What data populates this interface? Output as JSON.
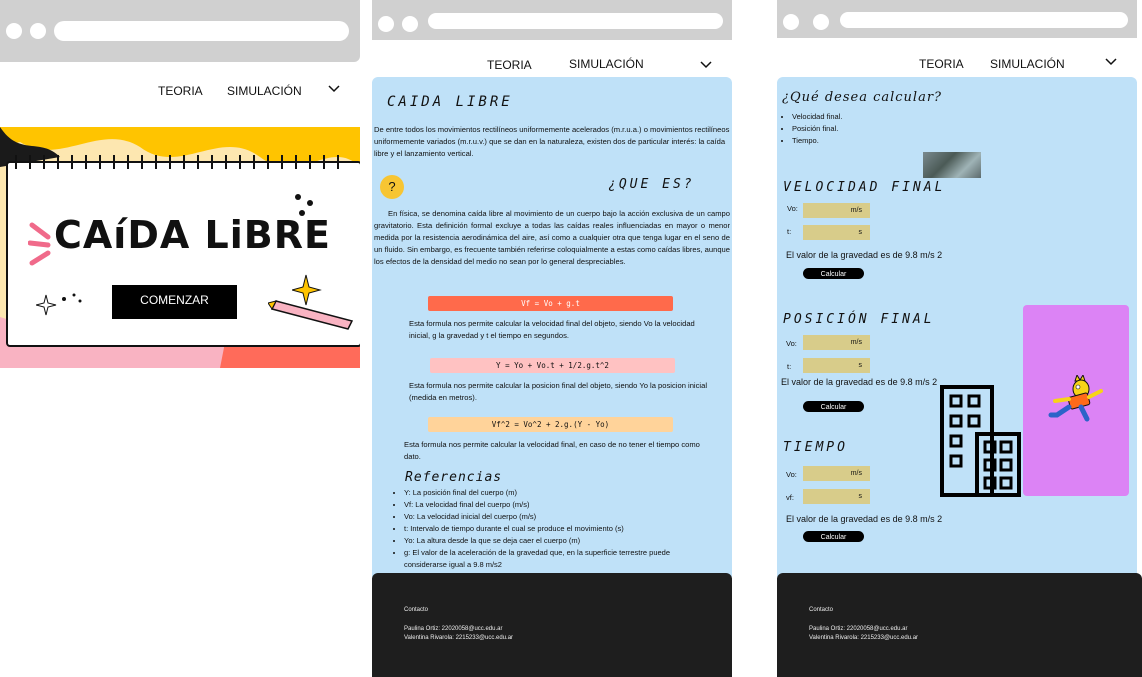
{
  "nav": {
    "teoria": "TEORIA",
    "simulacion": "SIMULACIÓN"
  },
  "home": {
    "title": "CAíDA LiBRE",
    "button": "COMENZAR"
  },
  "theory": {
    "title": "CAIDA LIBRE",
    "intro": "De entre todos los movimientos rectilíneos uniformemente acelerados (m.r.u.a.) o movimientos rectilíneos uniformemente variados (m.r.u.v.) que se dan en la naturaleza, existen dos de particular interés: la caída libre y el lanzamiento vertical.",
    "question": "¿QUE ES?",
    "definition": "En física, se denomina caída libre al movimiento de un cuerpo bajo la acción exclusiva de un campo gravitatorio. Esta definición formal excluye a todas las caídas reales influenciadas en mayor o menor medida por la resistencia aerodinámica del aire, así como a cualquier otra que tenga lugar en el seno de un fluido. Sin embargo, es frecuente también referirse coloquialmente a estas como caídas libres, aunque los efectos de la densidad del medio no sean por lo general despreciables.",
    "formulas": [
      {
        "text": "Vf = Vo + g.t",
        "desc": "Esta formula nos permite calcular la velocidad final del objeto, siendo Vo la velocidad inicial, g la gravedad y t el tiempo en segundos.",
        "color": "#ff6a4b"
      },
      {
        "text": "Y = Yo + Vo.t + 1/2.g.t^2",
        "desc": "Esta formula nos permite calcular la posicion final del objeto, siendo Yo la posicion inicial (medida en metros).",
        "color": "#ffc2c2"
      },
      {
        "text": "Vf^2 = Vo^2 + 2.g.(Y - Yo)",
        "desc": "Esta formula nos permite calcular la velocidad final, en caso de no tener el tiempo como dato.",
        "color": "#ffd39a"
      }
    ],
    "refs_title": "Referencias",
    "refs": [
      "Y: La posición final del cuerpo (m)",
      "Vf: La velocidad final del cuerpo (m/s)",
      "Vo: La velocidad inicial del cuerpo (m/s)",
      "t: Intervalo de tiempo durante el cual se produce el movimiento (s)",
      "Yo: La altura desde la que se deja caer el cuerpo (m)",
      "g: El valor de la aceleración de la gravedad que, en la superficie terrestre puede considerarse igual a 9.8 m/s2"
    ]
  },
  "footer": {
    "contact": "Contacto",
    "line1": "Paulina Ortiz: 22020058@ucc.edu.ar",
    "line2": "Valentina Rivarola: 2215233@ucc.edu.ar"
  },
  "sim": {
    "question": "¿Qué desea calcular?",
    "options": [
      "Velocidad final.",
      "Posición final.",
      "Tiempo."
    ],
    "sections": [
      {
        "title": "VELOCIDAD FINAL",
        "f1_label": "Vo:",
        "f1_unit": "m/s",
        "f2_label": "t:",
        "f2_unit": "s"
      },
      {
        "title": "POSICIÓN FINAL",
        "f1_label": "Vo:",
        "f1_unit": "m/s",
        "f2_label": "t:",
        "f2_unit": "s"
      },
      {
        "title": "TIEMPO",
        "f1_label": "Vo:",
        "f1_unit": "m/s",
        "f2_label": "vf:",
        "f2_unit": "s"
      }
    ],
    "gravity_note": "El valor de la gravedad es de 9.8 m/s 2",
    "calc_label": "Calcular",
    "colors": {
      "purple_box": "#dc83f5",
      "panel": "#bfe1f8"
    }
  }
}
